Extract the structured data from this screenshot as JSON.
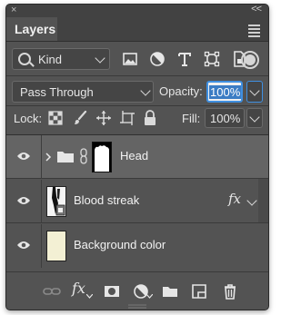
{
  "panel": {
    "tab_title": "Layers",
    "collapse_glyph": "<<",
    "close_glyph": "×"
  },
  "filter": {
    "kind_label": "Kind",
    "icons": [
      "image-filter-icon",
      "adjustment-filter-icon",
      "type-filter-icon",
      "shape-filter-icon",
      "smart-object-filter-icon"
    ]
  },
  "blend": {
    "mode": "Pass Through",
    "opacity_label": "Opacity:",
    "opacity_value": "100%"
  },
  "lock": {
    "label": "Lock:",
    "fill_label": "Fill:",
    "fill_value": "100%"
  },
  "layers": [
    {
      "name": "Head",
      "type": "group",
      "selected": true
    },
    {
      "name": "Blood streak",
      "type": "layer",
      "effects": "fx"
    },
    {
      "name": "Background color",
      "type": "layer"
    }
  ],
  "bottom_icons": [
    "link-layers-icon",
    "fx-icon",
    "add-mask-icon",
    "adjustment-layer-icon",
    "new-group-icon",
    "new-layer-icon",
    "delete-layer-icon"
  ],
  "bottom_fx_label": "fx",
  "colors": {
    "panel_bg": "#535353",
    "selected_row": "#646464",
    "accent_blue": "#3f8fe0",
    "thumb_cream": "#f3f0d4"
  }
}
